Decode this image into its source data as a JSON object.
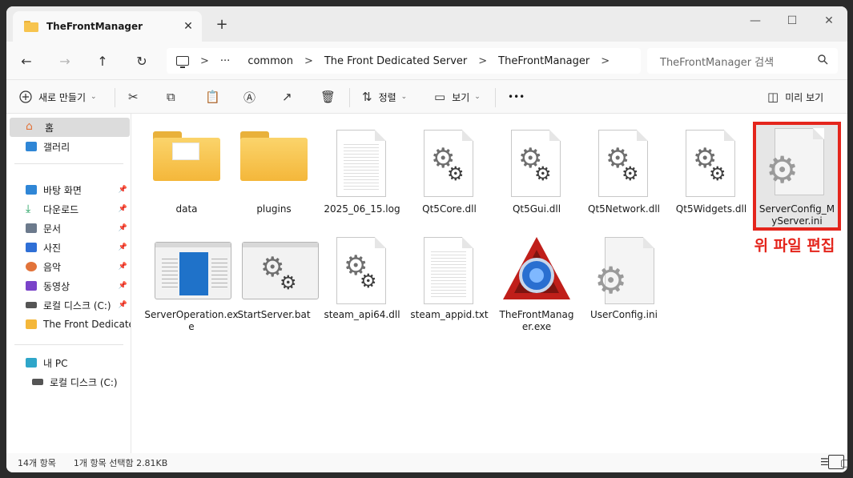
{
  "tab": {
    "title": "TheFrontManager",
    "close": "✕",
    "new": "+"
  },
  "window_controls": {
    "minimize": "—",
    "maximize": "☐",
    "close": "✕"
  },
  "nav": {
    "back": "←",
    "forward": "→",
    "up": "↑",
    "refresh": "↻"
  },
  "address": {
    "more": "···",
    "crumbs": [
      "common",
      "The Front Dedicated Server",
      "TheFrontManager"
    ],
    "sep": ">"
  },
  "search": {
    "placeholder": "TheFrontManager 검색",
    "icon": "search-icon"
  },
  "toolbar": {
    "new_label": "새로 만들기",
    "sort_label": "정렬",
    "view_label": "보기",
    "more_label": "•••",
    "preview_label": "미리 보기"
  },
  "sidebar": {
    "home": "홈",
    "gallery": "갤러리",
    "quick": [
      {
        "label": "바탕 화면",
        "color": "#2f86d6"
      },
      {
        "label": "다운로드",
        "color": "#1a9e5a"
      },
      {
        "label": "문서",
        "color": "#6c7a8c"
      },
      {
        "label": "사진",
        "color": "#2f6fd6"
      },
      {
        "label": "음악",
        "color": "#e2733a"
      },
      {
        "label": "동영상",
        "color": "#7a43c9"
      },
      {
        "label": "로컬 디스크 (C:)",
        "color": "#555555"
      }
    ],
    "folder_item": "The Front Dedicated",
    "pc": "내 PC",
    "pc_drive": "로컬 디스크 (C:)"
  },
  "files": [
    {
      "name": "data",
      "kind": "folder"
    },
    {
      "name": "plugins",
      "kind": "folder"
    },
    {
      "name": "2025_06_15.log",
      "kind": "text"
    },
    {
      "name": "Qt5Core.dll",
      "kind": "dll"
    },
    {
      "name": "Qt5Gui.dll",
      "kind": "dll"
    },
    {
      "name": "Qt5Network.dll",
      "kind": "dll"
    },
    {
      "name": "Qt5Widgets.dll",
      "kind": "dll"
    },
    {
      "name": "ServerConfig_MyServer.ini",
      "kind": "ini"
    },
    {
      "name": "ServerOperation.exe",
      "kind": "app"
    },
    {
      "name": "StartServer.bat",
      "kind": "bat"
    },
    {
      "name": "steam_api64.dll",
      "kind": "dll"
    },
    {
      "name": "steam_appid.txt",
      "kind": "text"
    },
    {
      "name": "TheFrontManager.exe",
      "kind": "exe"
    },
    {
      "name": "UserConfig.ini",
      "kind": "ini"
    }
  ],
  "annotation": "위 파일 편집",
  "status": {
    "count": "14개 항목",
    "selection": "1개 항목 선택함 2.81KB"
  },
  "colors": {
    "accent": "#e4251c",
    "folder": "#f4b73a"
  }
}
